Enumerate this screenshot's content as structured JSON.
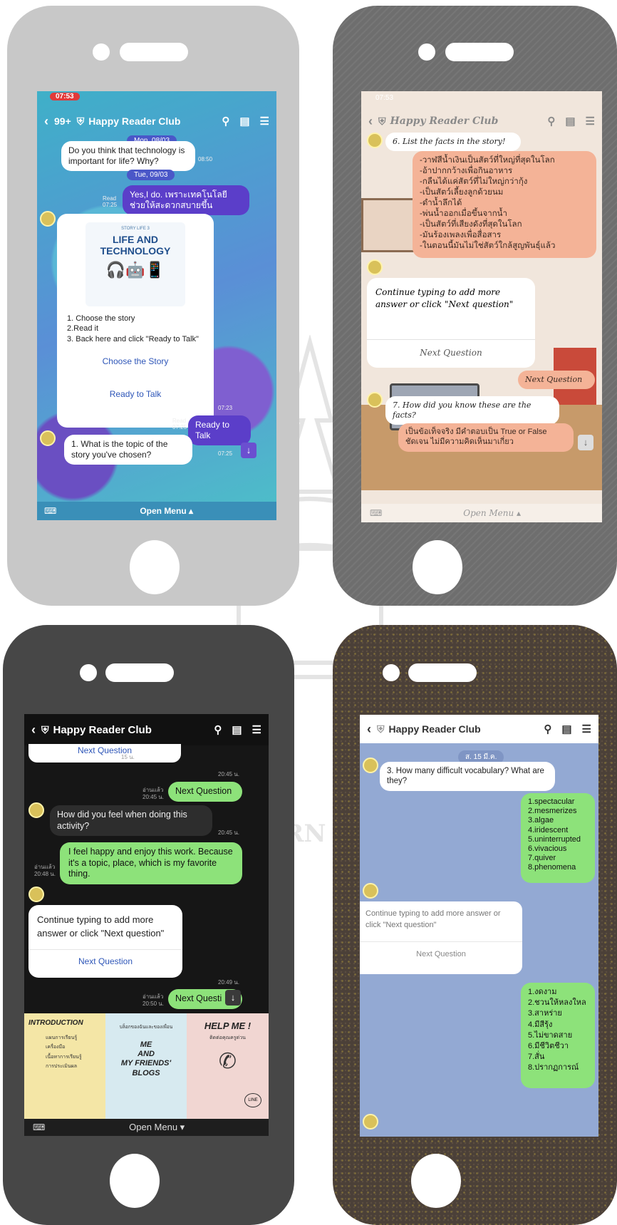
{
  "watermark": {
    "lines": [
      "มห",
      "KORN"
    ]
  },
  "phone1": {
    "status_time": "07:53",
    "header": {
      "back_count": "99+",
      "title": "Happy Reader Club"
    },
    "messages": {
      "date1": "Mon, 08/03",
      "q1": "Do you think that technology is important for life? Why?",
      "t1": "08:50",
      "date2": "Tue, 09/03",
      "a1": "Yes,I do. เพราะเทคโนโลยีช่วยให้สะดวกสบายขึ้น",
      "read1": "Read",
      "t2": "07:25",
      "card_title_small": "STORY LIFE 3",
      "card_title_1": "LIFE AND",
      "card_title_2": "TECHNOLOGY",
      "card_instructions": [
        "1. Choose the story",
        "2.Read it",
        "3. Back here and click \"Ready to Talk\""
      ],
      "card_btn1": "Choose the Story",
      "card_btn2": "Ready to Talk",
      "t3": "07:23",
      "read2": "Read",
      "t4": "07:25",
      "a2": "Ready to Talk",
      "q2": "1. What is the topic of the story you've chosen?",
      "t5": "07:25"
    },
    "footer": "Open Menu ▴"
  },
  "phone2": {
    "status_time": "07:53",
    "header": {
      "title": "Happy Reader Club",
      "title_prefix": "Happy"
    },
    "messages": {
      "q6": "6. List the facts in the story!",
      "answer_lines": [
        "-วาฬสีน้ำเงินเป็นสัตว์ที่ใหญ่ที่สุดในโลก",
        "-อ้าปากกว้างเพื่อกินอาหาร",
        "-กลืนได้แค่สัตว์ที่ไม่ใหญ่กว่ากุ้ง",
        "-เป็นสัตว์เลี้ยงลูกด้วยนม",
        "-ดำน้ำลึกได้",
        "-พ่นน้ำออกเมื่อขึ้นจากน้ำ",
        "-เป็นสัตว์ที่เสียงดังที่สุดในโลก",
        "-มันร้องเพลงเพื่อสื่อสาร",
        "-ในตอนนี้มันไม่ใช่สัตว์ใกล้สูญพันธุ์แล้ว"
      ],
      "card_text": "Continue typing to add more answer or click \"Next question\"",
      "card_btn": "Next Question",
      "a_next": "Next Question",
      "q7": "7. How did you know these are the facts?",
      "a7": "เป็นข้อเท็จจริง มีคำตอบเป็น True or False ชัดเจน ไม่มีความคิดเห็นมาเกี่ยว"
    },
    "footer": "Open Menu ▴"
  },
  "phone3": {
    "header": {
      "title": "Happy Reader Club"
    },
    "messages": {
      "top_partial": "Next Question",
      "top_time_pill": "15 น.",
      "t1": "20:45 น.",
      "read1": "อ่านแล้ว",
      "read1_time": "20:45 น.",
      "a1": "Next Question",
      "q1": "How did you feel when doing this activity?",
      "t2": "20:45 น.",
      "read2": "อ่านแล้ว",
      "read2_time": "20:48 น.",
      "a2": "I feel happy and enjoy this work. Because it's a topic, place, which is my favorite thing.",
      "card_text": "Continue typing to add more answer or click \"Next question\"",
      "card_btn": "Next Question",
      "t3": "20:49 น.",
      "read3": "อ่านแล้ว",
      "read3_time": "20:50 น.",
      "a3": "Next Questi"
    },
    "menu": {
      "intro_title": "INTRODUCTION",
      "intro_items": [
        "แผนการเรียนรู้",
        "เครื่องมือ",
        "เนื้อหาการเรียนรู้",
        "การประเมินผล"
      ],
      "blog_top": "บล็อกของฉันและของเพื่อน",
      "blog_lines": [
        "ME",
        "AND",
        "MY FRIENDS'",
        "BLOGS"
      ],
      "help_title": "HELP ME !",
      "help_sub": "ติดต่อคุณครูด่วน",
      "help_badge": "LINE"
    },
    "footer": "Open Menu ▾"
  },
  "phone4": {
    "header": {
      "title": "Happy Reader Club"
    },
    "messages": {
      "date": "ส. 15 มี.ค.",
      "q3": "3. How many difficult vocabulary? What are they?",
      "answer_en": [
        "1.spectacular",
        "2.mesmerizes",
        "3.algae",
        "4.iridescent",
        "5.uninterrupted",
        "6.vivacious",
        "7.quiver",
        "8.phenomena"
      ],
      "card_text": "Continue typing to add more answer or click \"Next question\"",
      "card_btn": "Next Question",
      "answer_th": [
        "1.งดงาม",
        "2.ชวนให้หลงใหล",
        "3.สาหร่าย",
        "4.มีสีรุ้ง",
        "5.ไม่ขาดสาย",
        "6.มีชีวิตชีวา",
        "7.สั่น",
        "8.ปรากฏการณ์"
      ]
    }
  }
}
